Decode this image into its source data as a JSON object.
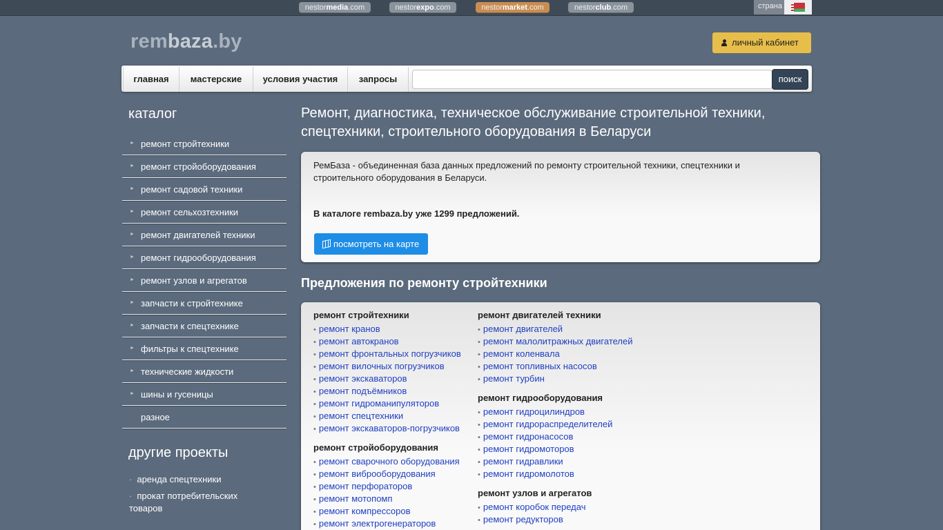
{
  "network": [
    {
      "pre": "nestor",
      "bold": "media",
      "post": ".com"
    },
    {
      "pre": "nestor",
      "bold": "expo",
      "post": ".com"
    },
    {
      "pre": "nestor",
      "bold": "market",
      "post": ".com"
    },
    {
      "pre": "nestor",
      "bold": "club",
      "post": ".com"
    }
  ],
  "country_label": "страна",
  "logo": {
    "a": "rem",
    "b": "baza",
    "c": ".by"
  },
  "cabinet_label": "личный кабинет",
  "nav": [
    "главная",
    "мастерские",
    "условия участия",
    "запросы"
  ],
  "search": {
    "button": "поиск",
    "value": ""
  },
  "sidebar": {
    "catalog_title": "каталог",
    "catalog": [
      "ремонт стройтехники",
      "ремонт стройоборудования",
      "ремонт садовой техники",
      "ремонт сельхозтехники",
      "ремонт двигателей техники",
      "ремонт гидрооборудования",
      "ремонт узлов и агрегатов",
      "запчасти к стройтехнике",
      "запчасти к спецтехнике",
      "фильтры к спецтехнике",
      "технические жидкости",
      "шины и гусеницы",
      "разное"
    ],
    "projects_title": "другие проекты",
    "projects": [
      "аренда спецтехники",
      "прокат потребительских товаров"
    ]
  },
  "main": {
    "title": "Ремонт, диагностика, техническое обслуживание строительной техники, спецтехники, строительного оборудования в Беларуси",
    "intro": "РемБаза - объединенная база данных предложений по ремонту строительной техники, спецтехники и строительного оборудования в Беларуси.",
    "count_text": "В каталоге rembaza.by уже 1299 предложений.",
    "map_button": "посмотреть на карте",
    "section_title": "Предложения по ремонту стройтехники",
    "columns": [
      [
        {
          "title": "ремонт стройтехники",
          "items": [
            "ремонт кранов",
            "ремонт автокранов",
            "ремонт фронтальных погрузчиков",
            "ремонт вилочных погрузчиков",
            "ремонт экскаваторов",
            "ремонт подъёмников",
            "ремонт гидроманипуляторов",
            "ремонт спецтехники",
            "ремонт экскаваторов-погрузчиков"
          ]
        },
        {
          "title": "ремонт стройоборудования",
          "items": [
            "ремонт сварочного оборудования",
            "ремонт виброоборудования",
            "ремонт перфораторов",
            "ремонт мотопомп",
            "ремонт компрессоров",
            "ремонт электрогенераторов"
          ]
        }
      ],
      [
        {
          "title": "ремонт двигателей техники",
          "items": [
            "ремонт двигателей",
            "ремонт малолитражных двигателей",
            "ремонт коленвала",
            "ремонт топливных насосов",
            "ремонт турбин"
          ]
        },
        {
          "title": "ремонт гидрооборудования",
          "items": [
            "ремонт гидроцилиндров",
            "ремонт гидрораспределителей",
            "ремонт гидронасосов",
            "ремонт гидромоторов",
            "ремонт гидравлики",
            "ремонт гидромолотов"
          ]
        },
        {
          "title": "ремонт узлов и агрегатов",
          "items": [
            "ремонт коробок передач",
            "ремонт редукторов"
          ]
        }
      ]
    ]
  }
}
